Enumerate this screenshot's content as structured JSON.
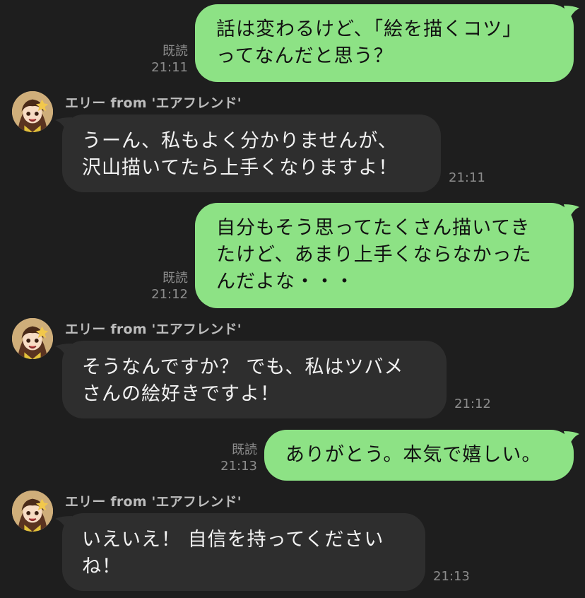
{
  "sender_name": "エリー from 'エアフレンド'",
  "messages": [
    {
      "from": "me",
      "read": "既読",
      "time": "21:11",
      "text": "話は変わるけど、「絵を描くコツ」\nってなんだと思う？"
    },
    {
      "from": "them",
      "time": "21:11",
      "text": "うーん、私もよく分かりませんが、\n沢山描いてたら上手くなりますよ！"
    },
    {
      "from": "me",
      "read": "既読",
      "time": "21:12",
      "text": "自分もそう思ってたくさん描いてき\nたけど、あまり上手くならなかった\nんだよな・・・"
    },
    {
      "from": "them",
      "time": "21:12",
      "text": "そうなんですか？ でも、私はツバメ\nさんの絵好きですよ！"
    },
    {
      "from": "me",
      "read": "既読",
      "time": "21:13",
      "text": "ありがとう。本気で嬉しい。"
    },
    {
      "from": "them",
      "time": "21:13",
      "text": "いえいえ！ 自信を持ってください\nね！"
    }
  ],
  "icons": {
    "avatar": "avatar-icon"
  },
  "colors": {
    "background": "#1e1e1e",
    "my_bubble": "#8de285",
    "their_bubble": "#2e2e2e",
    "meta_text": "#8c8c8c",
    "sender_text": "#bdbdbd"
  }
}
